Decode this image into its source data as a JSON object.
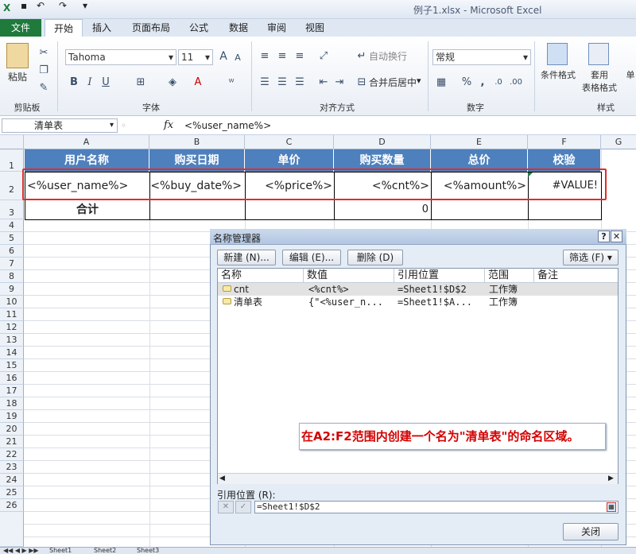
{
  "window": {
    "title": "例子1.xlsx - Microsoft Excel"
  },
  "ribbon": {
    "file_tab": "文件",
    "tabs": [
      "开始",
      "插入",
      "页面布局",
      "公式",
      "数据",
      "审阅",
      "视图"
    ],
    "clipboard": {
      "paste": "粘贴",
      "label": "剪贴板"
    },
    "font": {
      "name": "Tahoma",
      "size": "11",
      "bold": "B",
      "italic": "I",
      "underline": "U",
      "grow": "A",
      "shrink": "A",
      "label": "字体"
    },
    "alignment": {
      "wrap": "自动换行",
      "merge": "合并后居中",
      "label": "对齐方式"
    },
    "number": {
      "format": "常规",
      "percent": "%",
      "comma": ",",
      "label": "数字"
    },
    "styles": {
      "conditional": "条件格式",
      "table_format_1": "套用",
      "table_format_2": "表格格式",
      "cell_styles": "单",
      "label": "样式"
    }
  },
  "formula_bar": {
    "name_box": "清单表",
    "fx": "fx",
    "content": "<%user_name%>"
  },
  "grid": {
    "columns": [
      "A",
      "B",
      "C",
      "D",
      "E",
      "F",
      "G"
    ],
    "rows": [
      "1",
      "2",
      "3",
      "4",
      "5",
      "6",
      "7",
      "8",
      "9",
      "10",
      "11",
      "12",
      "13",
      "14",
      "15",
      "16",
      "17",
      "18",
      "19",
      "20",
      "21",
      "22",
      "23",
      "24",
      "25",
      "26"
    ],
    "headers": [
      "用户名称",
      "购买日期",
      "单价",
      "购买数量",
      "总价",
      "校验"
    ],
    "row2": [
      "<%user_name%>",
      "<%buy_date%>",
      "<%price%>",
      "<%cnt%>",
      "<%amount%>",
      "#VALUE!"
    ],
    "row3": {
      "label": "合计",
      "d": "0"
    }
  },
  "dialog": {
    "title": "名称管理器",
    "help": "?",
    "close_x": "✕",
    "new_button": "新建 (N)...",
    "edit_button": "编辑 (E)...",
    "delete_button": "删除 (D)",
    "filter_button": "筛选 (F) ▾",
    "columns": [
      "名称",
      "数值",
      "引用位置",
      "范围",
      "备注"
    ],
    "rows": [
      {
        "name": "cnt",
        "value": "<%cnt%>",
        "ref": "=Sheet1!$D$2",
        "scope": "工作簿",
        "comment": ""
      },
      {
        "name": "清单表",
        "value": "{\"<%user_n...",
        "ref": "=Sheet1!$A...",
        "scope": "工作簿",
        "comment": ""
      }
    ],
    "ref_label": "引用位置 (R):",
    "ref_value": "=Sheet1!$D$2",
    "close_button": "关闭"
  },
  "annotation": {
    "text": "在A2:F2范围内创建一个名为\"清单表\"的命名区域。"
  },
  "sheets": [
    "Sheet1",
    "Sheet2",
    "Sheet3"
  ],
  "colors": {
    "header_fill": "#4e80bd",
    "file_tab": "#1f7a3c",
    "annotation_text": "#d40000",
    "highlight_box": "#e32b2b"
  }
}
